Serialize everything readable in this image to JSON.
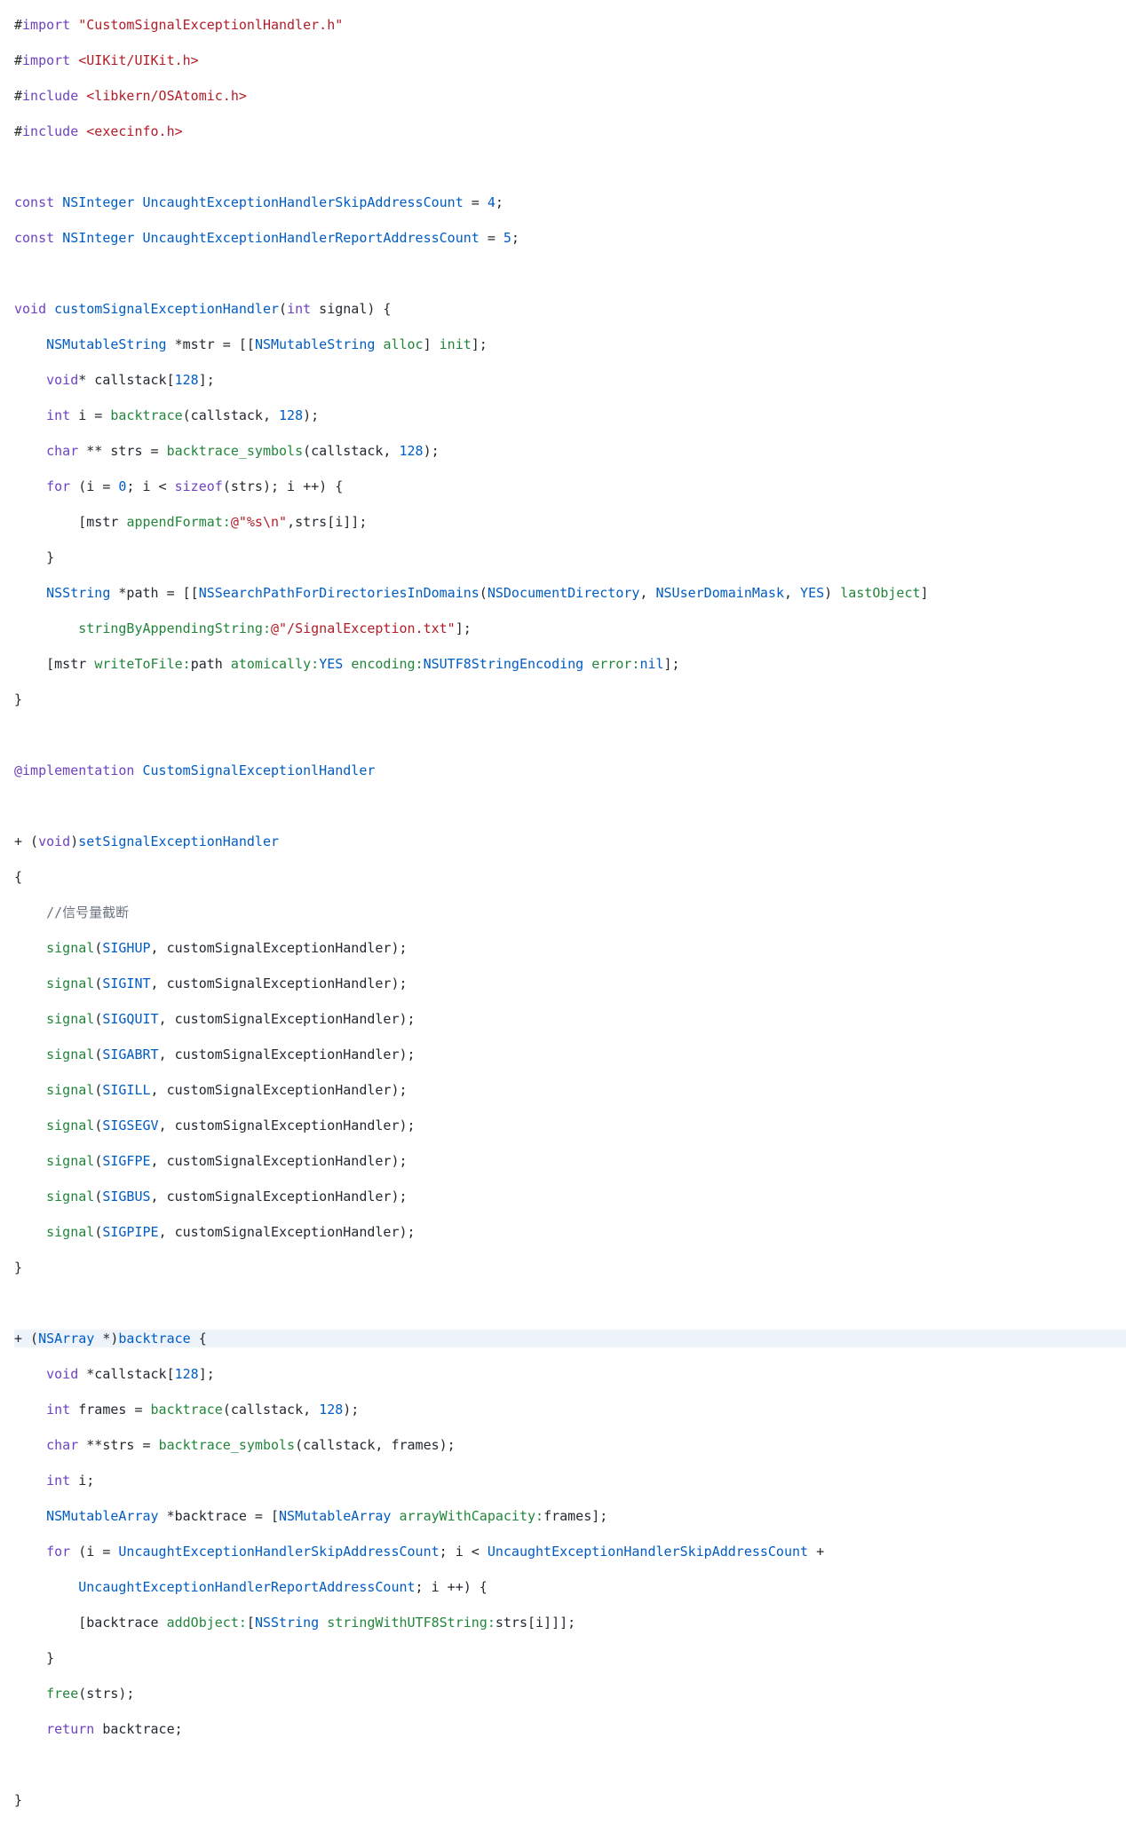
{
  "lines": [
    {
      "h": false,
      "t": [
        [
          "pl",
          "#"
        ],
        [
          "k",
          "import"
        ],
        [
          "pl",
          " "
        ],
        [
          "s",
          "\"CustomSignalExceptionlHandler.h\""
        ]
      ]
    },
    {
      "h": false,
      "t": [
        [
          "pl",
          "#"
        ],
        [
          "k",
          "import"
        ],
        [
          "pl",
          " "
        ],
        [
          "s",
          "<UIKit/UIKit.h>"
        ]
      ]
    },
    {
      "h": false,
      "t": [
        [
          "pl",
          "#"
        ],
        [
          "k",
          "include"
        ],
        [
          "pl",
          " "
        ],
        [
          "s",
          "<libkern/OSAtomic.h>"
        ]
      ]
    },
    {
      "h": false,
      "t": [
        [
          "pl",
          "#"
        ],
        [
          "k",
          "include"
        ],
        [
          "pl",
          " "
        ],
        [
          "s",
          "<execinfo.h>"
        ]
      ]
    },
    {
      "h": false,
      "t": [
        [
          "pl",
          ""
        ]
      ]
    },
    {
      "h": false,
      "t": [
        [
          "k",
          "const"
        ],
        [
          "pl",
          " "
        ],
        [
          "t",
          "NSInteger"
        ],
        [
          "pl",
          " "
        ],
        [
          "t",
          "UncaughtExceptionHandlerSkipAddressCount"
        ],
        [
          "pl",
          " = "
        ],
        [
          "n",
          "4"
        ],
        [
          "pl",
          ";"
        ]
      ]
    },
    {
      "h": false,
      "t": [
        [
          "k",
          "const"
        ],
        [
          "pl",
          " "
        ],
        [
          "t",
          "NSInteger"
        ],
        [
          "pl",
          " "
        ],
        [
          "t",
          "UncaughtExceptionHandlerReportAddressCount"
        ],
        [
          "pl",
          " = "
        ],
        [
          "n",
          "5"
        ],
        [
          "pl",
          ";"
        ]
      ]
    },
    {
      "h": false,
      "t": [
        [
          "pl",
          ""
        ]
      ]
    },
    {
      "h": false,
      "t": [
        [
          "k",
          "void"
        ],
        [
          "pl",
          " "
        ],
        [
          "t",
          "customSignalExceptionHandler"
        ],
        [
          "pl",
          "("
        ],
        [
          "k",
          "int"
        ],
        [
          "pl",
          " signal) {"
        ]
      ]
    },
    {
      "h": false,
      "t": [
        [
          "pl",
          "    "
        ],
        [
          "t",
          "NSMutableString"
        ],
        [
          "pl",
          " *mstr = [["
        ],
        [
          "t",
          "NSMutableString"
        ],
        [
          "pl",
          " "
        ],
        [
          "f",
          "alloc"
        ],
        [
          "pl",
          "] "
        ],
        [
          "f",
          "init"
        ],
        [
          "pl",
          "];"
        ]
      ]
    },
    {
      "h": false,
      "t": [
        [
          "pl",
          "    "
        ],
        [
          "k",
          "void"
        ],
        [
          "pl",
          "* callstack["
        ],
        [
          "n",
          "128"
        ],
        [
          "pl",
          "];"
        ]
      ]
    },
    {
      "h": false,
      "t": [
        [
          "pl",
          "    "
        ],
        [
          "k",
          "int"
        ],
        [
          "pl",
          " i = "
        ],
        [
          "f",
          "backtrace"
        ],
        [
          "pl",
          "(callstack, "
        ],
        [
          "n",
          "128"
        ],
        [
          "pl",
          ");"
        ]
      ]
    },
    {
      "h": false,
      "t": [
        [
          "pl",
          "    "
        ],
        [
          "k",
          "char"
        ],
        [
          "pl",
          " ** strs = "
        ],
        [
          "f",
          "backtrace_symbols"
        ],
        [
          "pl",
          "(callstack, "
        ],
        [
          "n",
          "128"
        ],
        [
          "pl",
          ");"
        ]
      ]
    },
    {
      "h": false,
      "t": [
        [
          "pl",
          "    "
        ],
        [
          "k",
          "for"
        ],
        [
          "pl",
          " (i = "
        ],
        [
          "n",
          "0"
        ],
        [
          "pl",
          "; i < "
        ],
        [
          "k",
          "sizeof"
        ],
        [
          "pl",
          "(strs); i ++) {"
        ]
      ]
    },
    {
      "h": false,
      "t": [
        [
          "pl",
          "        [mstr "
        ],
        [
          "f",
          "appendFormat:"
        ],
        [
          "s",
          "@\"%s\\n\""
        ],
        [
          "pl",
          ",strs[i]];"
        ]
      ]
    },
    {
      "h": false,
      "t": [
        [
          "pl",
          "    }"
        ]
      ]
    },
    {
      "h": false,
      "t": [
        [
          "pl",
          "    "
        ],
        [
          "t",
          "NSString"
        ],
        [
          "pl",
          " *path = [["
        ],
        [
          "t",
          "NSSearchPathForDirectoriesInDomains"
        ],
        [
          "pl",
          "("
        ],
        [
          "t",
          "NSDocumentDirectory"
        ],
        [
          "pl",
          ", "
        ],
        [
          "t",
          "NSUserDomainMask"
        ],
        [
          "pl",
          ", "
        ],
        [
          "n",
          "YES"
        ],
        [
          "pl",
          ") "
        ],
        [
          "f",
          "lastObject"
        ],
        [
          "pl",
          "]"
        ]
      ]
    },
    {
      "h": false,
      "t": [
        [
          "pl",
          "        "
        ],
        [
          "f",
          "stringByAppendingString:"
        ],
        [
          "s",
          "@\"/SignalException.txt\""
        ],
        [
          "pl",
          "];"
        ]
      ]
    },
    {
      "h": false,
      "t": [
        [
          "pl",
          "    [mstr "
        ],
        [
          "f",
          "writeToFile:"
        ],
        [
          "pl",
          "path "
        ],
        [
          "f",
          "atomically:"
        ],
        [
          "n",
          "YES"
        ],
        [
          "pl",
          " "
        ],
        [
          "f",
          "encoding:"
        ],
        [
          "t",
          "NSUTF8StringEncoding"
        ],
        [
          "pl",
          " "
        ],
        [
          "f",
          "error:"
        ],
        [
          "n",
          "nil"
        ],
        [
          "pl",
          "];"
        ]
      ]
    },
    {
      "h": false,
      "t": [
        [
          "pl",
          "}"
        ]
      ]
    },
    {
      "h": false,
      "t": [
        [
          "pl",
          ""
        ]
      ]
    },
    {
      "h": false,
      "t": [
        [
          "k",
          "@implementation"
        ],
        [
          "pl",
          " "
        ],
        [
          "t",
          "CustomSignalExceptionlHandler"
        ]
      ]
    },
    {
      "h": false,
      "t": [
        [
          "pl",
          ""
        ]
      ]
    },
    {
      "h": false,
      "t": [
        [
          "pl",
          "+ ("
        ],
        [
          "k",
          "void"
        ],
        [
          "pl",
          ")"
        ],
        [
          "t",
          "setSignalExceptionHandler"
        ]
      ]
    },
    {
      "h": false,
      "t": [
        [
          "pl",
          "{"
        ]
      ]
    },
    {
      "h": false,
      "t": [
        [
          "pl",
          "    "
        ],
        [
          "c",
          "//信号量截断"
        ]
      ]
    },
    {
      "h": false,
      "t": [
        [
          "pl",
          "    "
        ],
        [
          "f",
          "signal"
        ],
        [
          "pl",
          "("
        ],
        [
          "t",
          "SIGHUP"
        ],
        [
          "pl",
          ", customSignalExceptionHandler);"
        ]
      ]
    },
    {
      "h": false,
      "t": [
        [
          "pl",
          "    "
        ],
        [
          "f",
          "signal"
        ],
        [
          "pl",
          "("
        ],
        [
          "t",
          "SIGINT"
        ],
        [
          "pl",
          ", customSignalExceptionHandler);"
        ]
      ]
    },
    {
      "h": false,
      "t": [
        [
          "pl",
          "    "
        ],
        [
          "f",
          "signal"
        ],
        [
          "pl",
          "("
        ],
        [
          "t",
          "SIGQUIT"
        ],
        [
          "pl",
          ", customSignalExceptionHandler);"
        ]
      ]
    },
    {
      "h": false,
      "t": [
        [
          "pl",
          "    "
        ],
        [
          "f",
          "signal"
        ],
        [
          "pl",
          "("
        ],
        [
          "t",
          "SIGABRT"
        ],
        [
          "pl",
          ", customSignalExceptionHandler);"
        ]
      ]
    },
    {
      "h": false,
      "t": [
        [
          "pl",
          "    "
        ],
        [
          "f",
          "signal"
        ],
        [
          "pl",
          "("
        ],
        [
          "t",
          "SIGILL"
        ],
        [
          "pl",
          ", customSignalExceptionHandler);"
        ]
      ]
    },
    {
      "h": false,
      "t": [
        [
          "pl",
          "    "
        ],
        [
          "f",
          "signal"
        ],
        [
          "pl",
          "("
        ],
        [
          "t",
          "SIGSEGV"
        ],
        [
          "pl",
          ", customSignalExceptionHandler);"
        ]
      ]
    },
    {
      "h": false,
      "t": [
        [
          "pl",
          "    "
        ],
        [
          "f",
          "signal"
        ],
        [
          "pl",
          "("
        ],
        [
          "t",
          "SIGFPE"
        ],
        [
          "pl",
          ", customSignalExceptionHandler);"
        ]
      ]
    },
    {
      "h": false,
      "t": [
        [
          "pl",
          "    "
        ],
        [
          "f",
          "signal"
        ],
        [
          "pl",
          "("
        ],
        [
          "t",
          "SIGBUS"
        ],
        [
          "pl",
          ", customSignalExceptionHandler);"
        ]
      ]
    },
    {
      "h": false,
      "t": [
        [
          "pl",
          "    "
        ],
        [
          "f",
          "signal"
        ],
        [
          "pl",
          "("
        ],
        [
          "t",
          "SIGPIPE"
        ],
        [
          "pl",
          ", customSignalExceptionHandler);"
        ]
      ]
    },
    {
      "h": false,
      "t": [
        [
          "pl",
          "}"
        ]
      ]
    },
    {
      "h": false,
      "t": [
        [
          "pl",
          ""
        ]
      ]
    },
    {
      "h": true,
      "t": [
        [
          "pl",
          "+ ("
        ],
        [
          "t",
          "NSArray"
        ],
        [
          "pl",
          " *)"
        ],
        [
          "t",
          "backtrace"
        ],
        [
          "pl",
          " {"
        ]
      ]
    },
    {
      "h": false,
      "t": [
        [
          "pl",
          "    "
        ],
        [
          "k",
          "void"
        ],
        [
          "pl",
          " *callstack["
        ],
        [
          "n",
          "128"
        ],
        [
          "pl",
          "];"
        ]
      ]
    },
    {
      "h": false,
      "t": [
        [
          "pl",
          "    "
        ],
        [
          "k",
          "int"
        ],
        [
          "pl",
          " frames = "
        ],
        [
          "f",
          "backtrace"
        ],
        [
          "pl",
          "(callstack, "
        ],
        [
          "n",
          "128"
        ],
        [
          "pl",
          ");"
        ]
      ]
    },
    {
      "h": false,
      "t": [
        [
          "pl",
          "    "
        ],
        [
          "k",
          "char"
        ],
        [
          "pl",
          " **strs = "
        ],
        [
          "f",
          "backtrace_symbols"
        ],
        [
          "pl",
          "(callstack, frames);"
        ]
      ]
    },
    {
      "h": false,
      "t": [
        [
          "pl",
          "    "
        ],
        [
          "k",
          "int"
        ],
        [
          "pl",
          " i;"
        ]
      ]
    },
    {
      "h": false,
      "t": [
        [
          "pl",
          "    "
        ],
        [
          "t",
          "NSMutableArray"
        ],
        [
          "pl",
          " *backtrace = ["
        ],
        [
          "t",
          "NSMutableArray"
        ],
        [
          "pl",
          " "
        ],
        [
          "f",
          "arrayWithCapacity:"
        ],
        [
          "pl",
          "frames];"
        ]
      ]
    },
    {
      "h": false,
      "t": [
        [
          "pl",
          "    "
        ],
        [
          "k",
          "for"
        ],
        [
          "pl",
          " (i = "
        ],
        [
          "t",
          "UncaughtExceptionHandlerSkipAddressCount"
        ],
        [
          "pl",
          "; i < "
        ],
        [
          "t",
          "UncaughtExceptionHandlerSkipAddressCount"
        ],
        [
          "pl",
          " +"
        ]
      ]
    },
    {
      "h": false,
      "t": [
        [
          "pl",
          "        "
        ],
        [
          "t",
          "UncaughtExceptionHandlerReportAddressCount"
        ],
        [
          "pl",
          "; i ++) {"
        ]
      ]
    },
    {
      "h": false,
      "t": [
        [
          "pl",
          "        [backtrace "
        ],
        [
          "f",
          "addObject:"
        ],
        [
          "pl",
          "["
        ],
        [
          "t",
          "NSString"
        ],
        [
          "pl",
          " "
        ],
        [
          "f",
          "stringWithUTF8String:"
        ],
        [
          "pl",
          "strs[i]]];"
        ]
      ]
    },
    {
      "h": false,
      "t": [
        [
          "pl",
          "    }"
        ]
      ]
    },
    {
      "h": false,
      "t": [
        [
          "pl",
          "    "
        ],
        [
          "f",
          "free"
        ],
        [
          "pl",
          "(strs);"
        ]
      ]
    },
    {
      "h": false,
      "t": [
        [
          "pl",
          "    "
        ],
        [
          "k",
          "return"
        ],
        [
          "pl",
          " backtrace;"
        ]
      ]
    },
    {
      "h": false,
      "t": [
        [
          "pl",
          "    "
        ]
      ]
    },
    {
      "h": false,
      "t": [
        [
          "pl",
          "}"
        ]
      ]
    }
  ]
}
